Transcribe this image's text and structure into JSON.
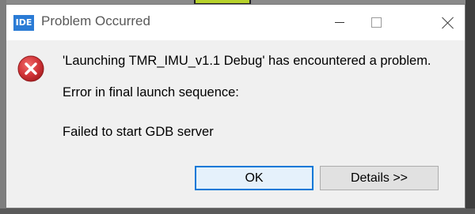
{
  "window": {
    "app_badge": "IDE",
    "title": "Problem Occurred",
    "minimize_label": "Minimize",
    "maximize_label": "Maximize",
    "close_label": "Close"
  },
  "message": {
    "heading": "'Launching TMR_IMU_v1.1 Debug' has encountered a problem.",
    "line1": "Error in final launch sequence:",
    "line2": "Failed to start GDB server"
  },
  "buttons": {
    "ok_label": "OK",
    "details_label": "Details >>"
  },
  "icons": {
    "app": "ide-logo-icon",
    "status": "error-icon"
  },
  "colors": {
    "accent": "#0078d7",
    "error": "#d13438",
    "app_badge": "#2a7bd5"
  }
}
